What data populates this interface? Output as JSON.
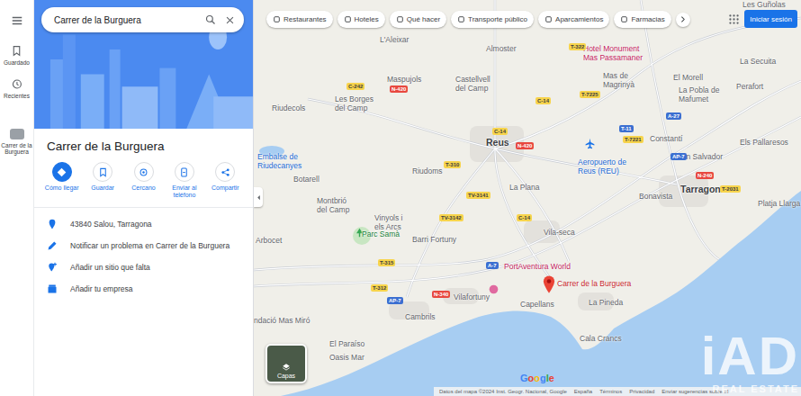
{
  "search": {
    "value": "Carrer de la Burguera"
  },
  "rail": [
    {
      "label": "Guardado",
      "selected": false
    },
    {
      "label": "Recientes",
      "selected": false
    },
    {
      "label": "Carrer de la Burguera",
      "selected": true
    }
  ],
  "place": {
    "title": "Carrer de la Burguera",
    "actions": [
      {
        "label": "Cómo llegar",
        "selected": true
      },
      {
        "label": "Guardar",
        "selected": false
      },
      {
        "label": "Cercano",
        "selected": false
      },
      {
        "label": "Enviar al teléfono",
        "selected": false
      },
      {
        "label": "Compartir",
        "selected": false
      }
    ],
    "info": [
      {
        "text": "43840 Salou, Tarragona",
        "kind": "address"
      },
      {
        "text": "Notificar un problema en Carrer de la Burguera",
        "kind": "edit"
      },
      {
        "text": "Añadir un sitio que falta",
        "kind": "addplace"
      },
      {
        "text": "Añadir tu empresa",
        "kind": "business"
      }
    ]
  },
  "chips": [
    "Restaurantes",
    "Hoteles",
    "Qué hacer",
    "Transporte público",
    "Aparcamientos",
    "Farmacias"
  ],
  "sign_in": "Iniciar sesión",
  "map": {
    "labels": [
      {
        "text": "Les Guñolas",
        "kind": "town"
      },
      {
        "text": "L'Aleixar",
        "kind": "town"
      },
      {
        "text": "Almoster",
        "kind": "town"
      },
      {
        "text": "Hotel Monument\nMas Passamaner",
        "kind": "poi"
      },
      {
        "text": "Mas de\nMagrinyà",
        "kind": "town"
      },
      {
        "text": "El Morell",
        "kind": "town"
      },
      {
        "text": "La Secuita",
        "kind": "town"
      },
      {
        "text": "Perafort",
        "kind": "town"
      },
      {
        "text": "La Pobla de\nMafumet",
        "kind": "town"
      },
      {
        "text": "Maspujols",
        "kind": "town"
      },
      {
        "text": "Castellvell\ndel Camp",
        "kind": "town"
      },
      {
        "text": "Riudecols",
        "kind": "town"
      },
      {
        "text": "Les Borges\ndel Camp",
        "kind": "town"
      },
      {
        "text": "Reus",
        "kind": "city"
      },
      {
        "text": "Constantí",
        "kind": "town"
      },
      {
        "text": "San Salvador",
        "kind": "town"
      },
      {
        "text": "Els Pallaresos",
        "kind": "town"
      },
      {
        "text": "Aeropuerto de\nReus (REU)",
        "kind": "transit"
      },
      {
        "text": "Tarragona",
        "kind": "city"
      },
      {
        "text": "Embalse de\nRiudecanyes",
        "kind": "water"
      },
      {
        "text": "Botarell",
        "kind": "town"
      },
      {
        "text": "Riudoms",
        "kind": "town"
      },
      {
        "text": "Montbrió\ndel Camp",
        "kind": "town"
      },
      {
        "text": "La Plana",
        "kind": "town"
      },
      {
        "text": "Bonavista",
        "kind": "town"
      },
      {
        "text": "Platja Llarga",
        "kind": "town"
      },
      {
        "text": "Vinyols i\nels Arcs",
        "kind": "town"
      },
      {
        "text": "Parc Samà",
        "kind": "park"
      },
      {
        "text": "Vila-seca",
        "kind": "town"
      },
      {
        "text": "Barri Fortuny",
        "kind": "town"
      },
      {
        "text": "PortAventura World",
        "kind": "poi"
      },
      {
        "text": "Arbocet",
        "kind": "town"
      },
      {
        "text": "Vilafortuny",
        "kind": "town"
      },
      {
        "text": "Cambrils",
        "kind": "town"
      },
      {
        "text": "Capellans",
        "kind": "town"
      },
      {
        "text": "La Pineda",
        "kind": "town"
      },
      {
        "text": "Cala Crancs",
        "kind": "town"
      },
      {
        "text": "El Paraíso",
        "kind": "town"
      },
      {
        "text": "Oasis Mar",
        "kind": "town"
      },
      {
        "text": "ndació Mas Miró",
        "kind": "town"
      }
    ],
    "roads": [
      {
        "text": "C-242",
        "kind": "regional"
      },
      {
        "text": "T-322",
        "kind": "regional"
      },
      {
        "text": "N-420",
        "kind": "national"
      },
      {
        "text": "C-14",
        "kind": "regional"
      },
      {
        "text": "T-7225",
        "kind": "regional"
      },
      {
        "text": "T-7221",
        "kind": "regional"
      },
      {
        "text": "C-14",
        "kind": "regional"
      },
      {
        "text": "N-420",
        "kind": "national"
      },
      {
        "text": "T-310",
        "kind": "regional"
      },
      {
        "text": "TV-3141",
        "kind": "regional"
      },
      {
        "text": "C-14",
        "kind": "regional"
      },
      {
        "text": "T-315",
        "kind": "regional"
      },
      {
        "text": "A-7",
        "kind": "motorway"
      },
      {
        "text": "N-340",
        "kind": "national"
      },
      {
        "text": "T-11",
        "kind": "motorway"
      },
      {
        "text": "A-27",
        "kind": "motorway"
      },
      {
        "text": "N-240",
        "kind": "national"
      },
      {
        "text": "AP-7",
        "kind": "motorway"
      },
      {
        "text": "T-2031",
        "kind": "regional"
      },
      {
        "text": "TV-3142",
        "kind": "regional"
      },
      {
        "text": "T-312",
        "kind": "regional"
      },
      {
        "text": "AP-7",
        "kind": "motorway"
      }
    ],
    "pin_label": "Carrer de la Burguera",
    "layers": "Capas",
    "logo": "Google"
  },
  "footer": [
    "Datos del mapa ©2024 Inst. Geogr. Nacional, Google",
    "España",
    "Términos",
    "Privacidad",
    "Enviar sugerencias sobre el"
  ],
  "watermark": {
    "logo": "iAD",
    "tagline": "REAL ESTATE"
  }
}
